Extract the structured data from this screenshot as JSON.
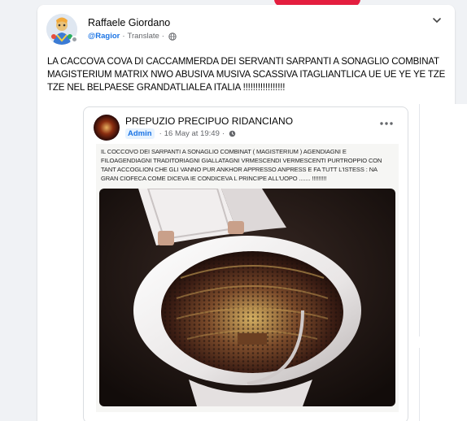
{
  "post": {
    "author": "Raffaele Giordano",
    "handle": "@Ragior",
    "translate": "Translate",
    "separator": "·",
    "text": "LA CACCOVA COVA DI CACCAMMERDA DEI SERVANTI SARPANTI A SONAGLIO COMBINAT MAGISTERIUM MATRIX NWO ABUSIVA MUSIVA SCASSIVA ITAGLIANTLICA UE UE YE YE TZE TZE NEL BELPAESE GRANDATLIALEA ITALIA !!!!!!!!!!!!!!!!!"
  },
  "shared": {
    "author": "PREPUZIO PRECIPUO RIDANCIANO",
    "badge": "Admin",
    "separator": "·",
    "date": "16 May at 19:49",
    "meme_text": "IL COCCOVO DEI SARPANTI A SONAGLIO COMBINAT ( MAGISTERIUM ) AGENDIAGNI E FILOAGENDIAGNI TRADITORIAGNI GIALLATAGNI VRMESCENDI VERMESCENTI PURTROPPIO CON TANT ACCOGLION CHE GLI VANNO PUR ANKHOR APPRESSO ANPRESS E FA TUTT L'ISTESS : NA GRAN CIOFECA COME DICEVA IE CONDICEVA L PRINCIPE ALL'UOPO ....... !!!!!!!!!"
  },
  "icons": {
    "globe": "globe-icon",
    "clock": "clock-icon",
    "chevron": "chevron-down-icon",
    "more": "more-options-icon"
  },
  "colors": {
    "accent": "#1b74e4",
    "alert": "#e41e3f"
  }
}
